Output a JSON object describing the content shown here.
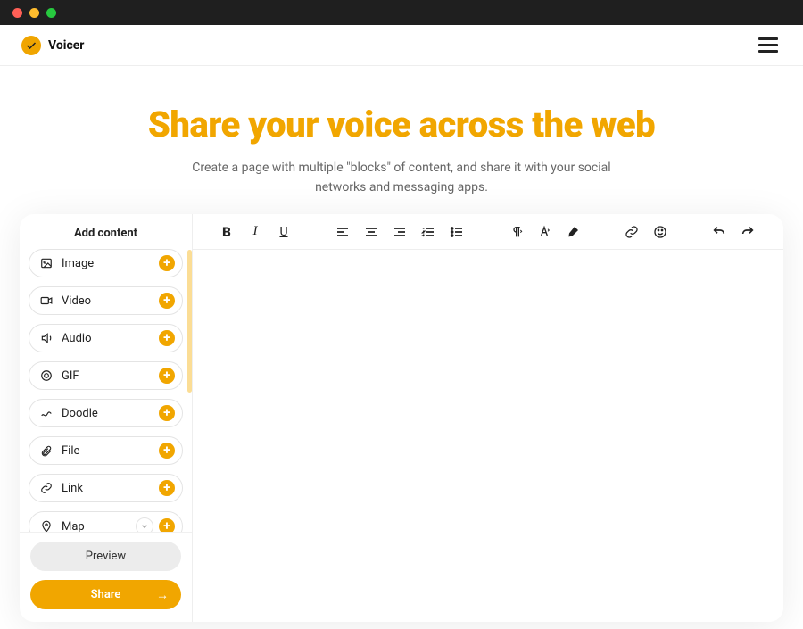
{
  "brand": {
    "name": "Voicer"
  },
  "hero": {
    "title": "Share your voice across the web",
    "subtitle": "Create a page with multiple \"blocks\" of content, and share it with your social networks and messaging apps."
  },
  "sidebar": {
    "title": "Add content",
    "items": [
      {
        "label": "Image",
        "icon": "image-icon"
      },
      {
        "label": "Video",
        "icon": "video-icon"
      },
      {
        "label": "Audio",
        "icon": "audio-icon"
      },
      {
        "label": "GIF",
        "icon": "gif-icon"
      },
      {
        "label": "Doodle",
        "icon": "doodle-icon"
      },
      {
        "label": "File",
        "icon": "file-icon"
      },
      {
        "label": "Link",
        "icon": "link-icon"
      },
      {
        "label": "Map",
        "icon": "map-icon"
      }
    ],
    "preview_label": "Preview",
    "share_label": "Share"
  },
  "toolbar": {
    "bold": "B",
    "italic": "I",
    "underline": "U"
  }
}
